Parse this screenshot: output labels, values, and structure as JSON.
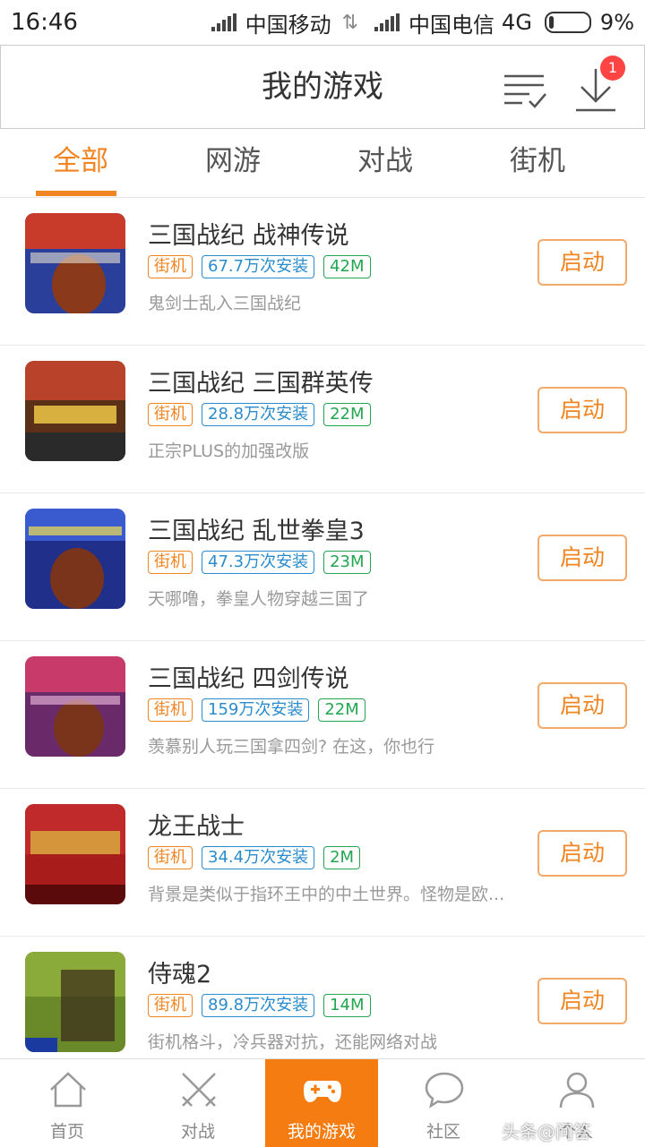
{
  "status_bar": {
    "time": "16:46",
    "carrier1": "中国移动",
    "carrier2": "中国电信",
    "network": "4G",
    "battery": "9%"
  },
  "header": {
    "title": "我的游戏",
    "download_badge": "1",
    "icons": [
      "list-check-icon",
      "download-icon"
    ]
  },
  "tabs": [
    {
      "label": "全部",
      "active": true
    },
    {
      "label": "网游",
      "active": false
    },
    {
      "label": "对战",
      "active": false
    },
    {
      "label": "街机",
      "active": false
    }
  ],
  "games": [
    {
      "name": "三国战纪 战神传说",
      "category": "街机",
      "installs": "67.7万次安装",
      "size": "42M",
      "desc": "鬼剑士乱入三国战纪",
      "button": "启动"
    },
    {
      "name": "三国战纪 三国群英传",
      "category": "街机",
      "installs": "28.8万次安装",
      "size": "22M",
      "desc": "正宗PLUS的加强改版",
      "button": "启动"
    },
    {
      "name": "三国战纪 乱世拳皇3",
      "category": "街机",
      "installs": "47.3万次安装",
      "size": "23M",
      "desc": "天哪噜，拳皇人物穿越三国了",
      "button": "启动"
    },
    {
      "name": "三国战纪 四剑传说",
      "category": "街机",
      "installs": "159万次安装",
      "size": "22M",
      "desc": "羡慕别人玩三国拿四剑? 在这，你也行",
      "button": "启动"
    },
    {
      "name": "龙王战士",
      "category": "街机",
      "installs": "34.4万次安装",
      "size": "2M",
      "desc": "背景是类似于指环王中的中土世界。怪物是欧...",
      "button": "启动"
    },
    {
      "name": "侍魂2",
      "category": "街机",
      "installs": "89.8万次安装",
      "size": "14M",
      "desc": "街机格斗，冷兵器对抗，还能网络对战",
      "button": "启动"
    }
  ],
  "bottom_nav": [
    {
      "label": "首页",
      "icon": "home-icon",
      "active": false
    },
    {
      "label": "对战",
      "icon": "crossed-swords-icon",
      "active": false
    },
    {
      "label": "我的游戏",
      "icon": "gamepad-icon",
      "active": true
    },
    {
      "label": "社区",
      "icon": "chat-bubble-icon",
      "active": false
    },
    {
      "label": "个人",
      "icon": "user-icon",
      "active": false
    }
  ],
  "watermark": "头条@问答",
  "colors": {
    "accent": "#f08522",
    "install_tag": "#2a8ccc",
    "size_tag": "#22a650",
    "badge": "#ff4444"
  }
}
